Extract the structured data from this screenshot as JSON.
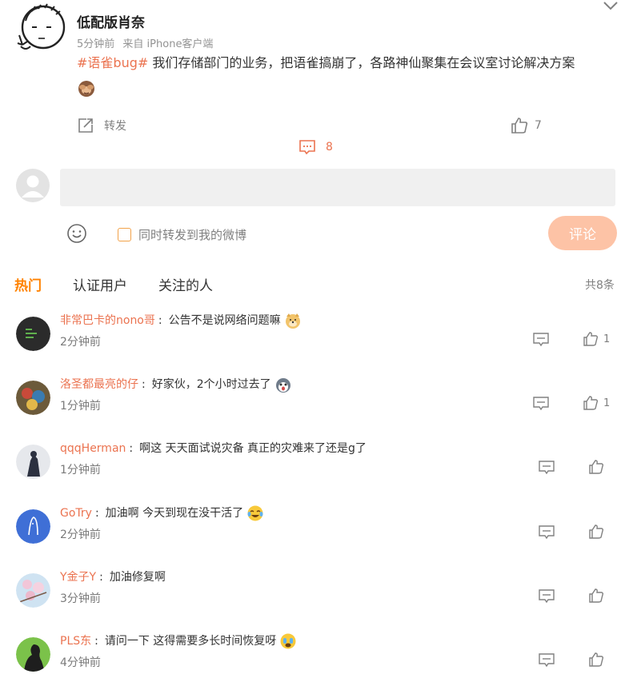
{
  "post": {
    "author": "低配版肖奈",
    "time": "5分钟前",
    "source": "来自 iPhone客户端",
    "topic": "#语雀bug#",
    "text": " 我们存储部门的业务，把语雀搞崩了，各路神仙聚集在会议室讨论解决方案",
    "emoji": "see-no-evil-monkey-emoji"
  },
  "actions": {
    "repost_label": "转发",
    "comment_count": "8",
    "like_count": "7"
  },
  "composer": {
    "placeholder": "",
    "sync_label": "同时转发到我的微博",
    "submit_label": "评论"
  },
  "tabs": [
    {
      "label": "热门",
      "active": true
    },
    {
      "label": "认证用户",
      "active": false
    },
    {
      "label": "关注的人",
      "active": false
    }
  ],
  "total_label": "共8条",
  "comments": [
    {
      "name": "非常巴卡的nono哥",
      "text": "公告不是说网络问题嘛",
      "emoji": "doge-emoji",
      "time": "2分钟前",
      "likes": "1"
    },
    {
      "name": "洛圣都最亮的仔",
      "text": "好家伙，2个小时过去了",
      "emoji": "husky-emoji",
      "time": "1分钟前",
      "likes": "1"
    },
    {
      "name": "qqqHerman",
      "text": "啊这 天天面试说灾备 真正的灾难来了还是g了",
      "emoji": "",
      "time": "1分钟前",
      "likes": ""
    },
    {
      "name": "GoTry",
      "text": "加油啊 今天到现在没干活了",
      "emoji": "tears-of-joy-emoji",
      "time": "2分钟前",
      "likes": ""
    },
    {
      "name": "Y金子Y",
      "text": "加油修复啊",
      "emoji": "",
      "time": "3分钟前",
      "likes": ""
    },
    {
      "name": "PLS东",
      "text": "请问一下 这得需要多长时间恢复呀",
      "emoji": "crying-emoji",
      "time": "4分钟前",
      "likes": ""
    }
  ],
  "colors": {
    "accent": "#ff8200",
    "name": "#eb7350",
    "submit_bg": "#fdc3a6",
    "input_bg": "#f0f0f0"
  }
}
